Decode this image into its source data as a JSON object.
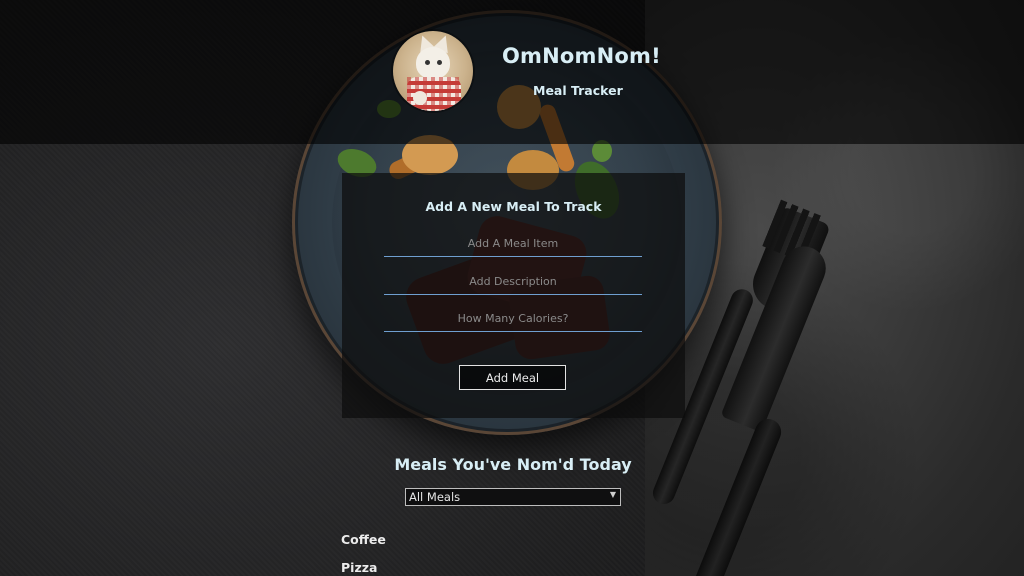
{
  "app": {
    "title": "OmNomNom!",
    "subtitle": "Meal Tracker"
  },
  "form": {
    "heading": "Add A New Meal To Track",
    "meal_item_placeholder": "Add A Meal Item",
    "description_placeholder": "Add Description",
    "calories_placeholder": "How Many Calories?",
    "submit_label": "Add Meal"
  },
  "meals": {
    "heading": "Meals You've Nom'd Today",
    "filter": {
      "selected": "All Meals"
    },
    "items": [
      {
        "name": "Coffee"
      },
      {
        "name": "Pizza"
      }
    ]
  },
  "colors": {
    "accent_text": "#d8eef5",
    "input_underline": "#6f9fd0",
    "panel_bg": "rgba(12,12,12,0.72)"
  },
  "icons": {
    "avatar": "cat-with-bib-avatar",
    "select_caret": "chevron-down-icon"
  }
}
